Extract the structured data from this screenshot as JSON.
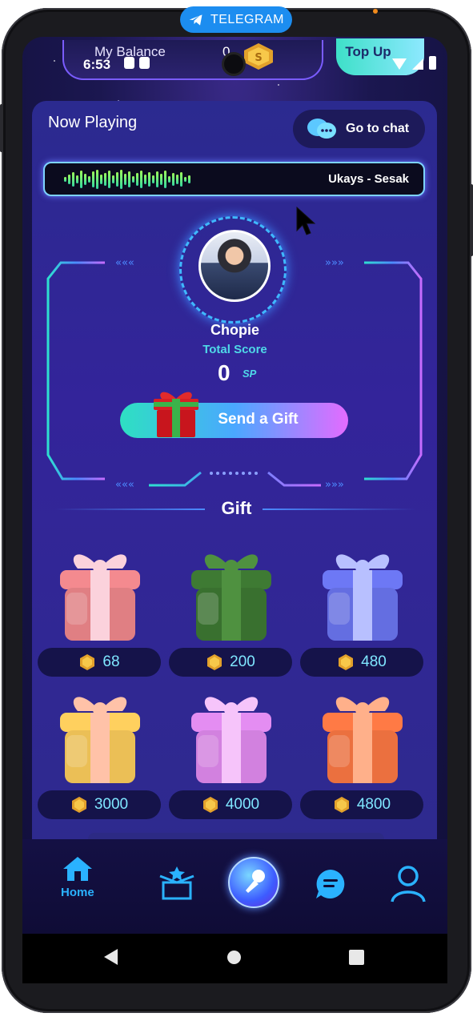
{
  "overlay": {
    "telegram_label": "TELEGRAM"
  },
  "status_bar": {
    "time": "6:53"
  },
  "header": {
    "balance_label": "My Balance",
    "balance_value": "0",
    "topup_label": "Top Up"
  },
  "now_playing": {
    "label": "Now Playing",
    "chat_button": "Go to chat",
    "song": "Ukays - Sesak"
  },
  "profile": {
    "name": "Chopie",
    "score_label": "Total Score",
    "score": "0",
    "score_unit": "SP",
    "send_gift_label": "Send a Gift"
  },
  "gifts": {
    "heading": "Gift",
    "items": [
      {
        "price": "68",
        "color": "#f48a8f",
        "ribbon": "#fbd2dc"
      },
      {
        "price": "200",
        "color": "#3e7a33",
        "ribbon": "#4f9140"
      },
      {
        "price": "480",
        "color": "#6d78f5",
        "ribbon": "#b8c0ff"
      },
      {
        "price": "3000",
        "color": "#ffd05e",
        "ribbon": "#ffc2a8"
      },
      {
        "price": "4000",
        "color": "#e48df2",
        "ribbon": "#f6c4fa"
      },
      {
        "price": "4800",
        "color": "#ff7a45",
        "ribbon": "#ffb08a"
      }
    ]
  },
  "nav": {
    "home_label": "Home",
    "icons": [
      "home-icon",
      "gift-box-icon",
      "microphone-icon",
      "chat-icon",
      "profile-icon"
    ],
    "accent": "#2ab2ff"
  }
}
